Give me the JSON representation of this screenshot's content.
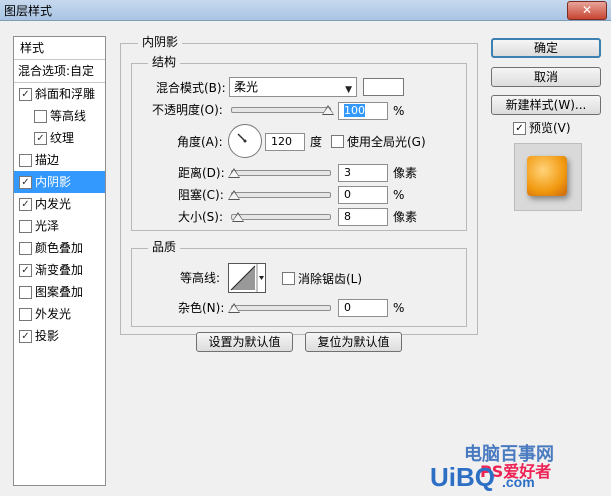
{
  "window": {
    "title": "图层样式",
    "close_label": "✕"
  },
  "sidebar": {
    "header": "样式",
    "blend_options": "混合选项:自定",
    "items": [
      {
        "label": "斜面和浮雕",
        "checked": true,
        "indent": false,
        "selected": false
      },
      {
        "label": "等高线",
        "checked": false,
        "indent": true,
        "selected": false
      },
      {
        "label": "纹理",
        "checked": true,
        "indent": true,
        "selected": false
      },
      {
        "label": "描边",
        "checked": false,
        "indent": false,
        "selected": false
      },
      {
        "label": "内阴影",
        "checked": true,
        "indent": false,
        "selected": true
      },
      {
        "label": "内发光",
        "checked": true,
        "indent": false,
        "selected": false
      },
      {
        "label": "光泽",
        "checked": false,
        "indent": false,
        "selected": false
      },
      {
        "label": "颜色叠加",
        "checked": false,
        "indent": false,
        "selected": false
      },
      {
        "label": "渐变叠加",
        "checked": true,
        "indent": false,
        "selected": false
      },
      {
        "label": "图案叠加",
        "checked": false,
        "indent": false,
        "selected": false
      },
      {
        "label": "外发光",
        "checked": false,
        "indent": false,
        "selected": false
      },
      {
        "label": "投影",
        "checked": true,
        "indent": false,
        "selected": false
      }
    ]
  },
  "panel": {
    "title": "内阴影",
    "structure": {
      "title": "结构",
      "blend_mode_label": "混合模式(B):",
      "blend_mode_value": "柔光",
      "opacity_label": "不透明度(O):",
      "opacity_value": "100",
      "opacity_level": 1.0,
      "percent": "%",
      "angle_label": "角度(A):",
      "angle_value": "120",
      "degree": "度",
      "global_light_label": "使用全局光(G)",
      "global_light_checked": false,
      "distance_label": "距离(D):",
      "distance_value": "3",
      "choke_label": "阻塞(C):",
      "choke_value": "0",
      "size_label": "大小(S):",
      "size_value": "8",
      "pixels": "像素"
    },
    "quality": {
      "title": "品质",
      "contour_label": "等高线:",
      "antialias_label": "消除锯齿(L)",
      "antialias_checked": false,
      "noise_label": "杂色(N):",
      "noise_value": "0",
      "percent": "%"
    },
    "set_default": "设置为默认值",
    "reset_default": "复位为默认值"
  },
  "buttons": {
    "ok": "确定",
    "cancel": "取消",
    "new_style": "新建样式(W)...",
    "preview_label": "预览(V)",
    "preview_checked": true
  },
  "watermark": {
    "site_name": "电脑百事网",
    "brand": "PS爱好者",
    "url_left": "UiBQ",
    "url_right": ".com"
  }
}
